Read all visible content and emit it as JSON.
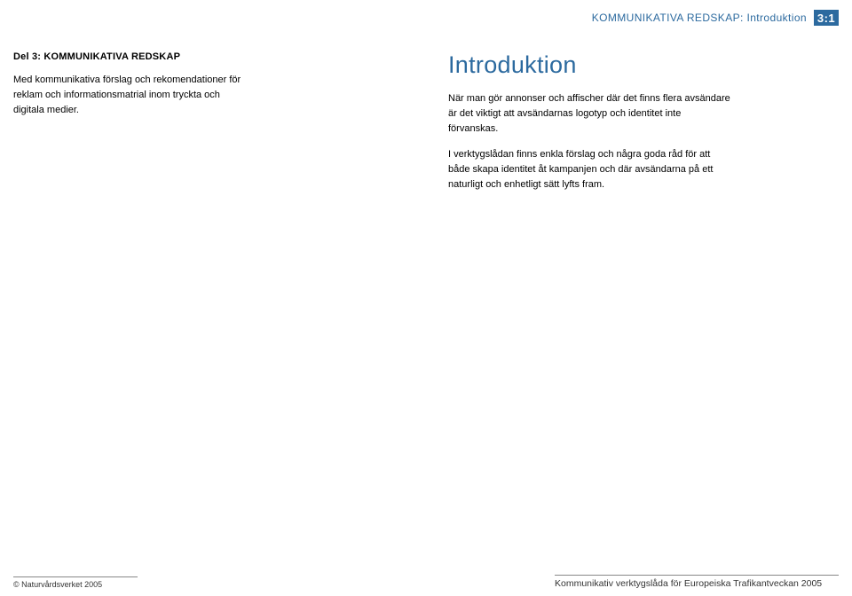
{
  "header": {
    "title": "KOMMUNIKATIVA REDSKAP: Introduktion",
    "page_number": "3:1"
  },
  "left": {
    "section_label": "Del 3: KOMMUNIKATIVA REDSKAP",
    "intro": "Med kommunikativa förslag och rekomenda­tioner för reklam och informationsmatrial inom tryckta och digitala medier."
  },
  "right": {
    "heading": "Introduktion",
    "para1": "När man gör annonser och affischer där det finns flera av­sändare är det viktigt att avsändarnas logotyp och identitet inte förvanskas.",
    "para2": "I verktygslådan finns enkla förslag och några goda råd för att både skapa identitet åt kampanjen och där avsändarna på ett naturligt och enhetligt sätt lyfts fram."
  },
  "footer": {
    "left": "© Naturvårdsverket 2005",
    "right": "Kommunikativ verktygslåda för Europeiska Trafikantveckan 2005"
  }
}
